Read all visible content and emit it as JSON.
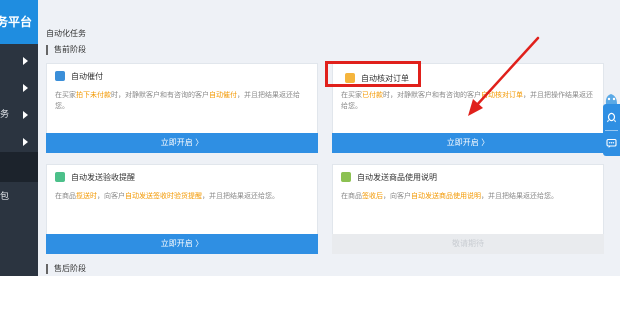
{
  "sidebar": {
    "brand": "务平台",
    "items": [
      {
        "label": "",
        "has_chevron": true
      },
      {
        "label": "",
        "has_chevron": true
      },
      {
        "label": "务",
        "has_chevron": true
      },
      {
        "label": "",
        "has_chevron": true
      },
      {
        "label": "包",
        "has_chevron": false
      }
    ]
  },
  "main": {
    "page_title": "自动化任务",
    "section_presale": "售前阶段",
    "section_aftersale": "售后阶段",
    "cards": [
      {
        "title": "自动催付",
        "icon": "reminder-icon",
        "desc_parts": [
          "在买家",
          "拍下未付款",
          "时，对静默客户和有咨询的客户",
          "自动催付",
          "，并且把结果返还给您。"
        ],
        "button": "立即开启 〉",
        "disabled": false
      },
      {
        "title": "自动核对订单",
        "icon": "order-check-icon",
        "desc_parts": [
          "在买家",
          "已付款",
          "时，对静默客户和有咨询的客户",
          "自动核对订单",
          "，并且把操作结果返还给您。"
        ],
        "button": "立即开启 〉",
        "disabled": false
      },
      {
        "title": "自动发送验收提醒",
        "icon": "acceptance-reminder-icon",
        "desc_parts": [
          "在商品",
          "揽送时",
          "，向客户",
          "自动发送签收时验货提醒",
          "，并且把结果返还给您。"
        ],
        "button": "立即开启 〉",
        "disabled": false
      },
      {
        "title": "自动发送商品使用说明",
        "icon": "product-manual-icon",
        "desc_parts": [
          "在商品",
          "签收后",
          "，向客户",
          "自动发送商品使用说明",
          "，并且把结果返还给您。"
        ],
        "button": "敬请期待",
        "disabled": true
      }
    ]
  },
  "colors": {
    "primary": "#2f8fe3",
    "highlight": "#f39800",
    "annotation_red": "#e0201b",
    "sidebar_bg": "#2b3440"
  }
}
